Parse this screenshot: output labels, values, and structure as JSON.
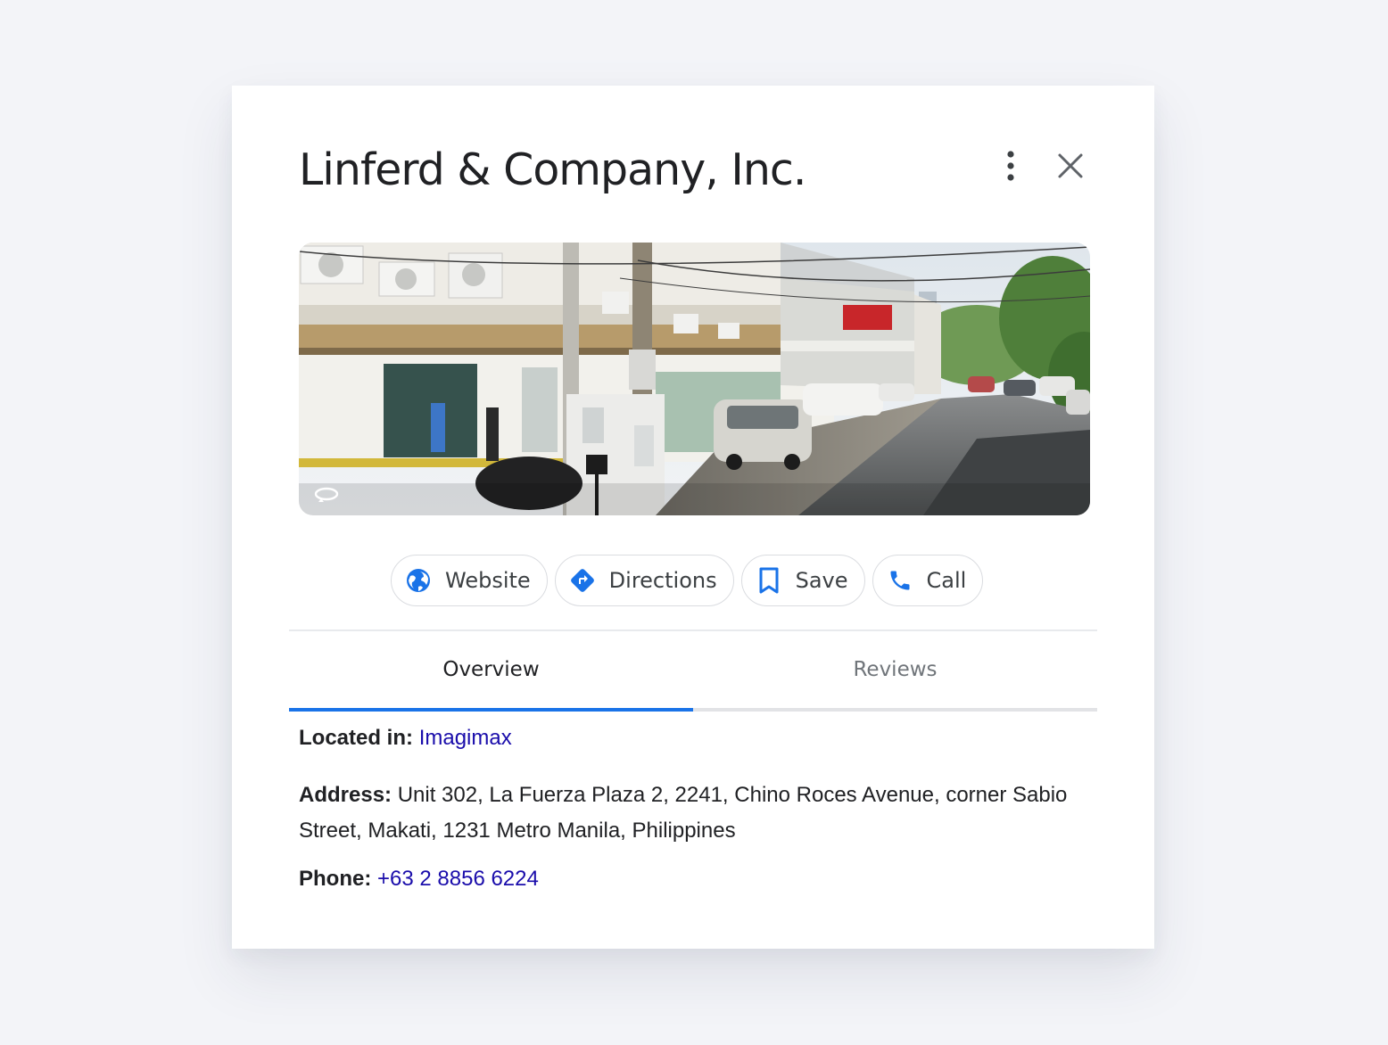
{
  "place": {
    "title": "Linferd & Company, Inc."
  },
  "icons": {
    "more": "more-vert-icon",
    "close": "close-icon",
    "photo_rotate": "360-rotate-icon",
    "website": "globe-icon",
    "directions": "directions-icon",
    "save": "bookmark-icon",
    "call": "phone-icon"
  },
  "actions": {
    "website": "Website",
    "directions": "Directions",
    "save": "Save",
    "call": "Call"
  },
  "tabs": {
    "overview": "Overview",
    "reviews": "Reviews",
    "active": "Overview"
  },
  "details": {
    "located_label": "Located in:",
    "located_value": "Imagimax",
    "address_label": "Address:",
    "address_value": "Unit 302, La Fuerza Plaza 2, 2241, Chino Roces Avenue, corner Sabio Street, Makati, 1231 Metro Manila, Philippines",
    "phone_label": "Phone:",
    "phone_value": "+63 2 8856 6224"
  },
  "colors": {
    "accent": "#1a73e8",
    "link": "#1a0dab",
    "background": "#f3f4f8"
  }
}
